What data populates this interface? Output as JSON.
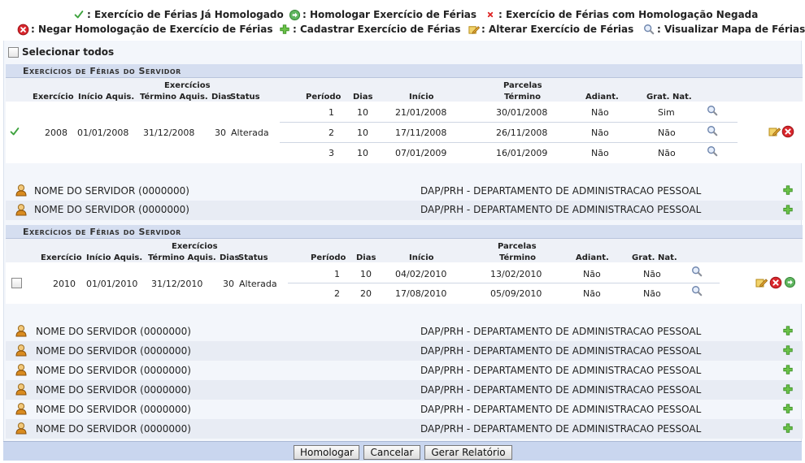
{
  "legend": {
    "homologated": ": Exercício de Férias Já Homologado",
    "homologate": ": Homologar Exercício de Férias",
    "denied": ": Exercício de Férias com Homologação Negada",
    "deny": ": Negar Homologação de Exercício de Férias",
    "register": ": Cadastrar Exercício de Férias",
    "edit": ": Alterar Exercício de Férias",
    "view_map": ": Visualizar Mapa de Férias"
  },
  "select_all_label": "Selecionar todos",
  "columns": {
    "exercicio": "Exercício",
    "inicio_aquis": "Início Aquis.",
    "exercicios_group": "Exercícios",
    "termino_aquis": "Término Aquis.",
    "dias": "Dias",
    "status": "Status",
    "periodo": "Período",
    "dias2": "Dias",
    "inicio": "Início",
    "parcelas_group": "Parcelas",
    "termino": "Término",
    "adiant": "Adiant.",
    "grat_nat": "Grat. Nat."
  },
  "sections": [
    {
      "title": "Exercícios de Férias do Servidor",
      "exercicio": "2008",
      "inicio_aquis": "01/01/2008",
      "termino_aquis": "31/12/2008",
      "dias": "30",
      "status": "Alterada",
      "parcelas": [
        {
          "periodo": "1",
          "dias": "10",
          "inicio": "21/01/2008",
          "termino": "30/01/2008",
          "adiant": "Não",
          "grat": "Sim"
        },
        {
          "periodo": "2",
          "dias": "10",
          "inicio": "17/11/2008",
          "termino": "26/11/2008",
          "adiant": "Não",
          "grat": "Não"
        },
        {
          "periodo": "3",
          "dias": "10",
          "inicio": "07/01/2009",
          "termino": "16/01/2009",
          "adiant": "Não",
          "grat": "Não"
        }
      ]
    },
    {
      "title": "Exercícios de Férias do Servidor",
      "exercicio": "2010",
      "inicio_aquis": "01/01/2010",
      "termino_aquis": "31/12/2010",
      "dias": "30",
      "status": "Alterada",
      "parcelas": [
        {
          "periodo": "1",
          "dias": "10",
          "inicio": "04/02/2010",
          "termino": "13/02/2010",
          "adiant": "Não",
          "grat": "Não"
        },
        {
          "periodo": "2",
          "dias": "20",
          "inicio": "17/08/2010",
          "termino": "05/09/2010",
          "adiant": "Não",
          "grat": "Não"
        }
      ]
    }
  ],
  "servers": [
    {
      "name": "NOME DO SERVIDOR (0000000)",
      "dept": "DAP/PRH - DEPARTAMENTO DE ADMINISTRACAO PESSOAL"
    },
    {
      "name": "NOME DO SERVIDOR (0000000)",
      "dept": "DAP/PRH - DEPARTAMENTO DE ADMINISTRACAO PESSOAL"
    },
    {
      "name": "NOME DO SERVIDOR (0000000)",
      "dept": "DAP/PRH - DEPARTAMENTO DE ADMINISTRACAO PESSOAL"
    },
    {
      "name": "NOME DO SERVIDOR (0000000)",
      "dept": "DAP/PRH - DEPARTAMENTO DE ADMINISTRACAO PESSOAL"
    },
    {
      "name": "NOME DO SERVIDOR (0000000)",
      "dept": "DAP/PRH - DEPARTAMENTO DE ADMINISTRACAO PESSOAL"
    },
    {
      "name": "NOME DO SERVIDOR (0000000)",
      "dept": "DAP/PRH - DEPARTAMENTO DE ADMINISTRACAO PESSOAL"
    },
    {
      "name": "NOME DO SERVIDOR (0000000)",
      "dept": "DAP/PRH - DEPARTAMENTO DE ADMINISTRACAO PESSOAL"
    },
    {
      "name": "NOME DO SERVIDOR (0000000)",
      "dept": "DAP/PRH - DEPARTAMENTO DE ADMINISTRACAO PESSOAL"
    }
  ],
  "buttons": {
    "homologar": "Homologar",
    "cancelar": "Cancelar",
    "gerar_relatorio": "Gerar Relatório"
  }
}
